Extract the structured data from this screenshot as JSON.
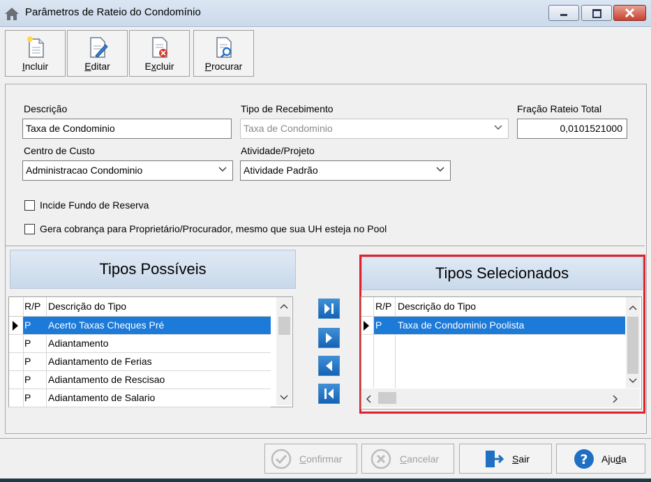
{
  "window": {
    "title": "Parâmetros de Rateio do Condomínio",
    "controls": [
      "minimize-icon",
      "maximize-icon",
      "close-icon"
    ]
  },
  "toolbar": {
    "incluir_key": "I",
    "incluir_rest": "ncluir",
    "editar_key": "E",
    "editar_rest": "ditar",
    "excluir_pre": "E",
    "excluir_key": "x",
    "excluir_rest": "cluir",
    "procurar_key": "P",
    "procurar_rest": "rocurar"
  },
  "form": {
    "descricao_label": "Descrição",
    "descricao_value": "Taxa de Condominio",
    "tipo_recebimento_label": "Tipo de Recebimento",
    "tipo_recebimento_value": "Taxa de Condominio",
    "fracao_label": "Fração Rateio Total",
    "fracao_value": "0,0101521000",
    "centro_custo_label": "Centro de Custo",
    "centro_custo_value": "Administracao Condominio",
    "atividade_label": "Atividade/Projeto",
    "atividade_value": "Atividade Padrão",
    "incide_fundo_label": "Incide Fundo de Reserva",
    "incide_fundo_checked": false,
    "gera_cobranca_label": "Gera cobrança para Proprietário/Procurador, mesmo que sua UH esteja no Pool",
    "gera_cobranca_checked": false
  },
  "possiveis": {
    "title": "Tipos Possíveis",
    "col_rp": "R/P",
    "col_desc": "Descrição do Tipo",
    "rows": [
      {
        "rp": "P",
        "desc": "Acerto Taxas Cheques Pré",
        "selected": true
      },
      {
        "rp": "P",
        "desc": "Adiantamento",
        "selected": false
      },
      {
        "rp": "P",
        "desc": "Adiantamento de Ferias",
        "selected": false
      },
      {
        "rp": "P",
        "desc": "Adiantamento de Rescisao",
        "selected": false
      },
      {
        "rp": "P",
        "desc": "Adiantamento de Salario",
        "selected": false
      }
    ]
  },
  "selecionados": {
    "title": "Tipos Selecionados",
    "col_rp": "R/P",
    "col_desc": "Descrição do Tipo",
    "rows": [
      {
        "rp": "P",
        "desc": "Taxa de Condominio Poolista",
        "selected": true
      }
    ]
  },
  "transfer_buttons": [
    "move-all-right-icon",
    "move-right-icon",
    "move-left-icon",
    "move-all-left-icon"
  ],
  "footer": {
    "confirmar_key": "C",
    "confirmar_rest": "onfirmar",
    "cancelar_key": "C",
    "cancelar_rest": "ancelar",
    "sair_key": "S",
    "sair_rest": "air",
    "ajuda_pre": "Aju",
    "ajuda_key": "d",
    "ajuda_rest": "a"
  },
  "colors": {
    "selection": "#1c7ad8",
    "highlight_border": "#e0202a",
    "arrow_blue": "#1f6fc2"
  }
}
